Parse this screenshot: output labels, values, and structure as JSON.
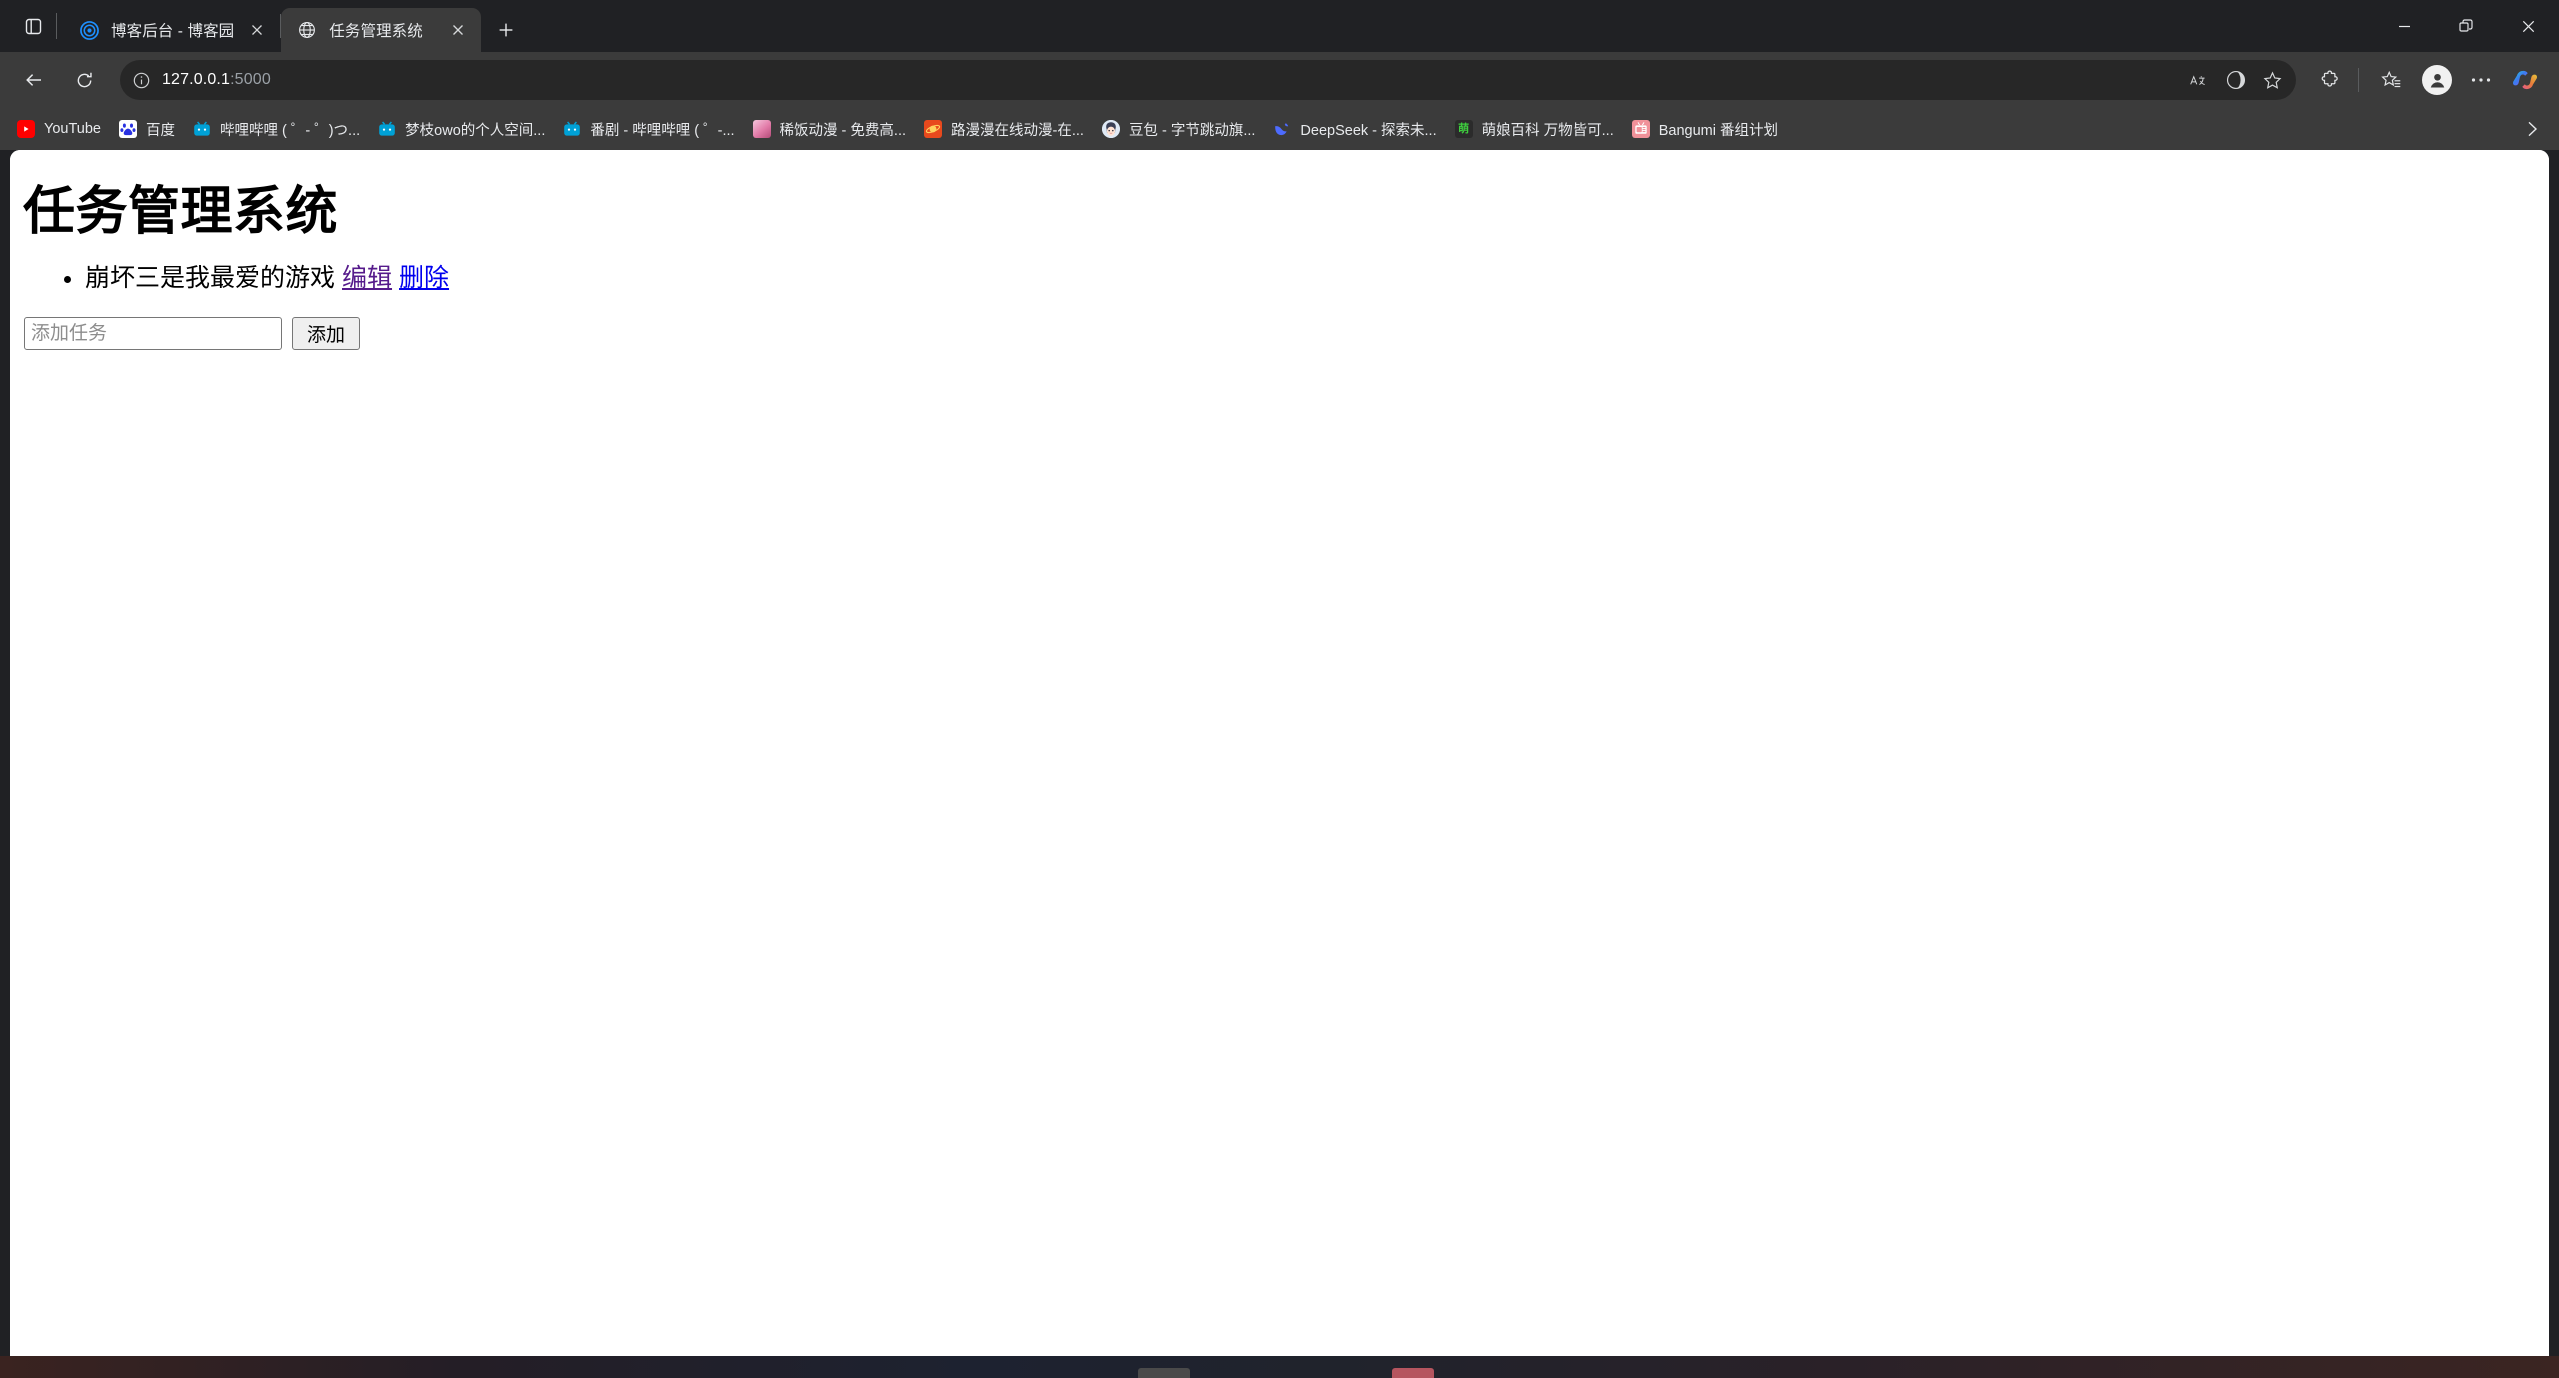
{
  "window": {
    "minimize_label": "最小化",
    "restore_label": "还原",
    "close_label": "关闭"
  },
  "tabstrip": {
    "tab_search_name": "标签页搜索",
    "new_tab_label": "新建标签页",
    "tabs": [
      {
        "title": "博客后台 - 博客园",
        "favicon": "cnblogs-logo",
        "active": false,
        "close_label": "关闭标签页"
      },
      {
        "title": "任务管理系统",
        "favicon": "globe-icon",
        "active": true,
        "close_label": "关闭标签页"
      }
    ]
  },
  "toolbar": {
    "back_label": "返回",
    "refresh_label": "刷新",
    "site_info_label": "查看站点信息",
    "url_host": "127.0.0.1",
    "url_port": ":5000",
    "url_full": "127.0.0.1:5000",
    "translate_label": "翻译此页",
    "copilot_page_label": "Copilot",
    "favorite_label": "添加到收藏夹",
    "extensions_label": "扩展",
    "collections_label": "集锦",
    "profile_label": "个人资料",
    "settings_label": "设置及其他",
    "copilot_label": "Copilot"
  },
  "bookmarks": {
    "overflow_label": "其他收藏夹",
    "items": [
      {
        "label": "YouTube",
        "icon": "youtube-icon",
        "glyph": "▶"
      },
      {
        "label": "百度",
        "icon": "baidu-icon",
        "glyph": "熊"
      },
      {
        "label": "哔哩哔哩 ( ゜- ゜)つ...",
        "icon": "bilibili-icon",
        "glyph": ""
      },
      {
        "label": "梦枝owo的个人空间...",
        "icon": "bilibili-icon",
        "glyph": ""
      },
      {
        "label": "番剧 - 哔哩哔哩 ( ゜-...",
        "icon": "bilibili-icon",
        "glyph": ""
      },
      {
        "label": "稀饭动漫 - 免费高...",
        "icon": "xifan-icon",
        "glyph": ""
      },
      {
        "label": "路漫漫在线动漫-在...",
        "icon": "lumanman-icon",
        "glyph": ""
      },
      {
        "label": "豆包 - 字节跳动旗...",
        "icon": "doubao-icon",
        "glyph": ""
      },
      {
        "label": "DeepSeek - 探索未...",
        "icon": "deepseek-icon",
        "glyph": ""
      },
      {
        "label": "萌娘百科 万物皆可...",
        "icon": "moegirl-icon",
        "glyph": "萌"
      },
      {
        "label": "Bangumi 番组计划",
        "icon": "bangumi-icon",
        "glyph": ""
      }
    ]
  },
  "page": {
    "title": "任务管理系统",
    "tasks": [
      {
        "text": "崩坏三是我最爱的游戏",
        "edit_label": "编辑",
        "delete_label": "删除"
      }
    ],
    "add_form": {
      "input_placeholder": "添加任务",
      "input_value": "",
      "submit_label": "添加"
    }
  },
  "colors": {
    "chrome_bg": "#202124",
    "toolbar_bg": "#3b3b3b",
    "omnibox_bg": "#272727",
    "active_tab_bg": "#3b3b3b",
    "page_bg": "#ffffff",
    "link_visited": "#551a8b",
    "link_default": "#0000ee"
  }
}
